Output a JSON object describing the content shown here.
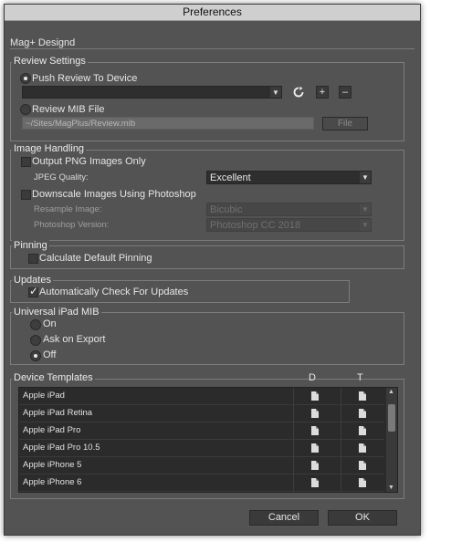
{
  "window": {
    "title": "Preferences",
    "app_name": "Mag+ Designd"
  },
  "review": {
    "section": "Review Settings",
    "push_label": "Push Review To Device",
    "mib_label": "Review MIB File",
    "mib_path": "~/Sites/MagPlus/Review.mib",
    "file_button": "File",
    "refresh_icon": "refresh-icon",
    "plus": "+",
    "minus": "–"
  },
  "image": {
    "section": "Image Handling",
    "output_png": "Output PNG Images Only",
    "jpeg_label": "JPEG Quality:",
    "jpeg_value": "Excellent",
    "downscale": "Downscale Images Using Photoshop",
    "resample_label": "Resample Image:",
    "resample_value": "Bicubic",
    "ps_label": "Photoshop Version:",
    "ps_value": "Photoshop CC 2018"
  },
  "pinning": {
    "section": "Pinning",
    "calc": "Calculate Default Pinning"
  },
  "updates": {
    "section": "Updates",
    "auto": "Automatically Check For Updates"
  },
  "universal": {
    "section": "Universal iPad MIB",
    "on": "On",
    "ask": "Ask on Export",
    "off": "Off"
  },
  "templates": {
    "section": "Device Templates",
    "col_d": "D",
    "col_t": "T",
    "rows": [
      "Apple iPad",
      "Apple iPad Retina",
      "Apple iPad Pro",
      "Apple iPad Pro 10.5",
      "Apple iPhone 5",
      "Apple iPhone 6"
    ]
  },
  "footer": {
    "cancel": "Cancel",
    "ok": "OK"
  }
}
